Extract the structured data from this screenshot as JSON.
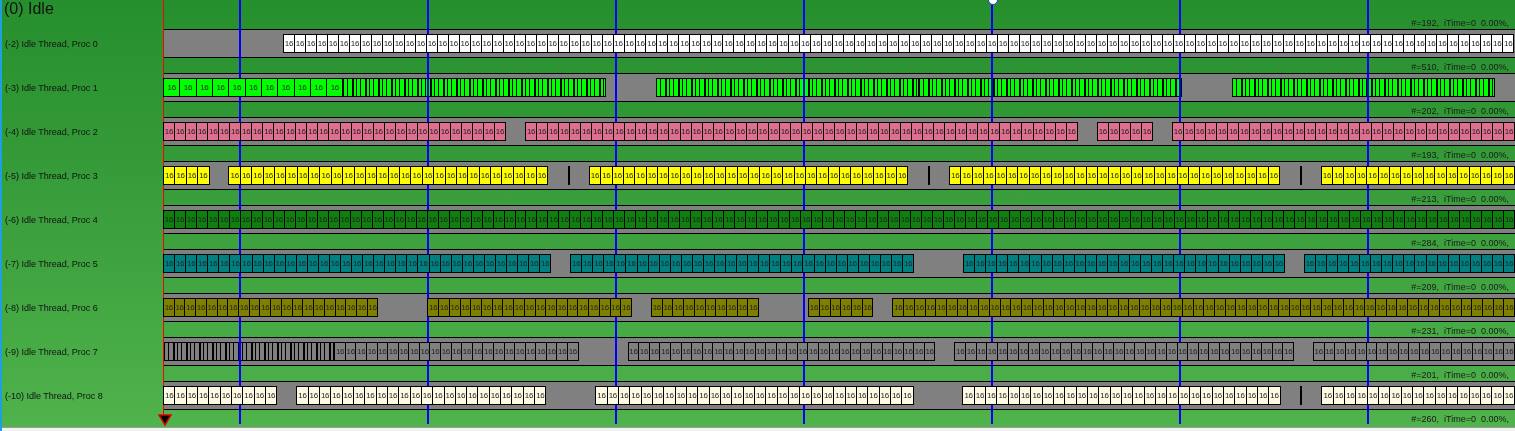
{
  "title": "(0) Idle",
  "rows": [
    {
      "label": "(-2) Idle Thread, Proc 0",
      "color": "#ffffff",
      "stats": "#=192,  iTime=0  0.00%,",
      "segments": [
        {
          "kind": "long_gap"
        },
        {
          "kind": "slices",
          "labels": [
            "16",
            "16",
            "16",
            "16",
            "16",
            "16",
            "16",
            "16",
            "16",
            "16",
            "16",
            "16",
            "16",
            "16",
            "16",
            "16",
            "16",
            "16",
            "16",
            "16",
            "16",
            "16",
            "16",
            "16",
            "16",
            "16",
            "16",
            "16",
            "16",
            "16",
            "16",
            "16",
            "16",
            "16",
            "16",
            "16",
            "16",
            "16",
            "16",
            "16",
            "16",
            "16",
            "16",
            "16",
            "16",
            "16",
            "16",
            "16",
            "16",
            "16",
            "16",
            "16",
            "16",
            "16",
            "16",
            "16",
            "16",
            "16",
            "16",
            "16",
            "16",
            "16",
            "16",
            "16",
            "16",
            "16",
            "16",
            "16",
            "16",
            "16",
            "16",
            "16",
            "16",
            "16",
            "16",
            "16",
            "16",
            "16",
            "16",
            "16",
            "16",
            "16",
            "16",
            "16",
            "16",
            "16",
            "16",
            "16",
            "16",
            "16",
            "16",
            "16",
            "16",
            "16",
            "16",
            "16",
            "16",
            "16",
            "16",
            "16",
            "16",
            "16",
            "16",
            "16",
            "16",
            "16",
            "16",
            "16",
            "16",
            "16",
            "16",
            "16"
          ]
        }
      ]
    },
    {
      "label": "(-3) Idle Thread, Proc 1",
      "color": "#00ff00",
      "stats": "#=510,  iTime=0  0.00%,",
      "segments": [
        {
          "kind": "slices",
          "labels": [
            "16",
            "16",
            "16",
            "16",
            "16",
            "16",
            "16",
            "16",
            "16",
            "16",
            "16"
          ]
        },
        {
          "kind": "stripes"
        },
        {
          "kind": "gap"
        },
        {
          "kind": "stripes"
        },
        {
          "kind": "stripes"
        },
        {
          "kind": "gap"
        },
        {
          "kind": "stripes"
        },
        {
          "kind": "short_gap"
        }
      ]
    },
    {
      "label": "(-4) Idle Thread, Proc 2",
      "color": "#de6f8f",
      "stats": "#=202,  iTime=0  0.00%,",
      "segments": [
        {
          "kind": "slices",
          "labels": [
            "16",
            "16",
            "16",
            "16",
            "16",
            "16",
            "16",
            "16",
            "16",
            "16",
            "16",
            "16",
            "16",
            "16",
            "16",
            "16",
            "16",
            "16",
            "16",
            "16",
            "16",
            "16",
            "16",
            "16",
            "16",
            "16",
            "16",
            "16",
            "16",
            "16",
            "16"
          ]
        },
        {
          "kind": "short_gap"
        },
        {
          "kind": "slices",
          "labels": [
            "16",
            "16",
            "16",
            "16",
            "16",
            "16",
            "16",
            "16",
            "16",
            "16",
            "16",
            "16",
            "16",
            "16",
            "16",
            "16",
            "16",
            "16",
            "16",
            "16",
            "16",
            "16",
            "16",
            "16",
            "16",
            "16",
            "16",
            "16",
            "16",
            "16",
            "16",
            "16",
            "16",
            "16",
            "16",
            "16",
            "16",
            "16",
            "16",
            "16",
            "16",
            "16",
            "16",
            "16",
            "16",
            "16",
            "16",
            "16",
            "16",
            "16"
          ]
        },
        {
          "kind": "short_gap"
        },
        {
          "kind": "slices",
          "labels": [
            "16",
            "16",
            "16",
            "16",
            "16"
          ]
        },
        {
          "kind": "short_gap"
        },
        {
          "kind": "slices",
          "labels": [
            "16",
            "16",
            "16",
            "16",
            "16",
            "16",
            "16",
            "16",
            "16",
            "16",
            "16",
            "16",
            "16",
            "16",
            "16",
            "16",
            "16",
            "16",
            "16",
            "16",
            "16",
            "16",
            "16",
            "16",
            "16",
            "16",
            "16",
            "16",
            "16",
            "16",
            "16"
          ]
        }
      ]
    },
    {
      "label": "(-5) Idle Thread, Proc 3",
      "color": "#ffff00",
      "stats": "#=193,  iTime=0  0.00%,",
      "segments": [
        {
          "kind": "slices",
          "labels": [
            "16",
            "16",
            "16",
            "16"
          ]
        },
        {
          "kind": "short_gap"
        },
        {
          "kind": "slices",
          "labels": [
            "16",
            "16",
            "16",
            "16",
            "16",
            "16",
            "16",
            "16",
            "16",
            "16",
            "16",
            "16",
            "16",
            "16",
            "16",
            "16",
            "16",
            "16",
            "16",
            "16",
            "16",
            "16",
            "16",
            "16",
            "16",
            "16",
            "16",
            "16"
          ]
        },
        {
          "kind": "short_gap"
        },
        {
          "kind": "tick"
        },
        {
          "kind": "short_gap"
        },
        {
          "kind": "slices",
          "labels": [
            "16",
            "16",
            "16",
            "16",
            "16",
            "16",
            "16",
            "16",
            "16",
            "16",
            "16",
            "16",
            "16",
            "16",
            "16",
            "16",
            "16",
            "16",
            "16",
            "16",
            "16",
            "16",
            "16",
            "16",
            "16",
            "16",
            "16",
            "16"
          ]
        },
        {
          "kind": "short_gap"
        },
        {
          "kind": "tick"
        },
        {
          "kind": "short_gap"
        },
        {
          "kind": "slices",
          "labels": [
            "16",
            "16",
            "16",
            "16",
            "16",
            "16",
            "16",
            "16",
            "16",
            "16",
            "16",
            "16",
            "16",
            "16",
            "16",
            "16",
            "16",
            "16",
            "16",
            "16",
            "16",
            "16",
            "16",
            "16",
            "16",
            "16",
            "16",
            "16",
            "16"
          ]
        },
        {
          "kind": "short_gap"
        },
        {
          "kind": "tick"
        },
        {
          "kind": "short_gap"
        },
        {
          "kind": "slices",
          "labels": [
            "16",
            "16",
            "16",
            "16",
            "16",
            "16",
            "16",
            "16",
            "16",
            "16",
            "16",
            "16",
            "16",
            "16",
            "16",
            "16",
            "16"
          ]
        }
      ]
    },
    {
      "label": "(-6) Idle Thread, Proc 4",
      "color": "#0f800f",
      "stats": "#=213,  iTime=0  0.00%,",
      "segments": [
        {
          "kind": "slices",
          "labels": [
            "16",
            "16",
            "16",
            "16",
            "16",
            "16",
            "16",
            "16",
            "16",
            "16",
            "16",
            "16",
            "16",
            "16",
            "16",
            "16",
            "16",
            "16",
            "16",
            "16",
            "16",
            "16",
            "16",
            "16",
            "16",
            "16",
            "16",
            "16",
            "16",
            "16",
            "16",
            "16",
            "16",
            "16",
            "16",
            "16",
            "16",
            "16",
            "16",
            "16",
            "16",
            "16",
            "16",
            "16",
            "16",
            "16",
            "16",
            "16",
            "16",
            "16",
            "16",
            "16",
            "16",
            "16",
            "16",
            "16",
            "16",
            "16",
            "16",
            "16",
            "16",
            "16",
            "16",
            "16",
            "16",
            "16",
            "16",
            "16",
            "16",
            "16",
            "16",
            "16",
            "16",
            "16",
            "16",
            "16",
            "16",
            "16",
            "16",
            "16",
            "16",
            "16",
            "16",
            "16",
            "16",
            "16",
            "16",
            "16",
            "16",
            "16",
            "16",
            "16",
            "16",
            "16",
            "16",
            "16",
            "16",
            "16",
            "16",
            "16",
            "16",
            "16",
            "16",
            "16",
            "16",
            "16",
            "16",
            "16",
            "16",
            "16",
            "16",
            "16",
            "16",
            "16",
            "16",
            "16",
            "16",
            "16",
            "16",
            "16",
            "16",
            "16",
            "16"
          ]
        }
      ]
    },
    {
      "label": "(-7) Idle Thread, Proc 5",
      "color": "#008080",
      "stats": "#=284,  iTime=0  0.00%,",
      "segments": [
        {
          "kind": "slices",
          "labels": [
            "16",
            "16",
            "16",
            "16",
            "16",
            "16",
            "16",
            "16",
            "16",
            "16",
            "16",
            "16",
            "16",
            "16",
            "16",
            "16",
            "16",
            "16",
            "16",
            "16",
            "16",
            "16",
            "16",
            "16",
            "16",
            "16",
            "16",
            "16",
            "16",
            "16",
            "16",
            "16",
            "16",
            "16",
            "16"
          ]
        },
        {
          "kind": "short_gap"
        },
        {
          "kind": "slices",
          "labels": [
            "16",
            "16",
            "16",
            "16",
            "16",
            "16",
            "16",
            "16",
            "16",
            "16",
            "16",
            "16",
            "16",
            "16",
            "16",
            "16",
            "16",
            "16",
            "16",
            "16",
            "16",
            "16",
            "16",
            "16",
            "16",
            "16",
            "16",
            "16",
            "16",
            "16",
            "16"
          ]
        },
        {
          "kind": "gap"
        },
        {
          "kind": "slices",
          "labels": [
            "16",
            "16",
            "16",
            "16",
            "16",
            "16",
            "16",
            "16",
            "16",
            "16",
            "16",
            "16",
            "16",
            "16",
            "16",
            "16",
            "16",
            "16",
            "16",
            "16",
            "16",
            "16",
            "16",
            "16",
            "16",
            "16",
            "16",
            "16",
            "16"
          ]
        },
        {
          "kind": "short_gap"
        },
        {
          "kind": "slices",
          "labels": [
            "16",
            "16",
            "16",
            "16",
            "16",
            "16",
            "16",
            "16",
            "16",
            "16",
            "16",
            "16",
            "16",
            "16",
            "16",
            "16",
            "16",
            "16",
            "16"
          ]
        }
      ]
    },
    {
      "label": "(-8) Idle Thread, Proc 6",
      "color": "#808000",
      "stats": "#=209,  iTime=0  0.00%,",
      "segments": [
        {
          "kind": "slices",
          "labels": [
            "16",
            "16",
            "16",
            "16",
            "16",
            "16",
            "16",
            "16",
            "16",
            "16",
            "16",
            "16",
            "16",
            "16",
            "16",
            "16",
            "16",
            "16",
            "16",
            "16"
          ]
        },
        {
          "kind": "gap"
        },
        {
          "kind": "slices",
          "labels": [
            "16",
            "16",
            "16",
            "16",
            "16",
            "16",
            "16",
            "16",
            "16",
            "16",
            "16",
            "16",
            "16",
            "16",
            "16",
            "16",
            "16",
            "16",
            "16"
          ]
        },
        {
          "kind": "short_gap"
        },
        {
          "kind": "slices",
          "labels": [
            "16",
            "16",
            "16",
            "16",
            "16",
            "16",
            "16",
            "16",
            "16",
            "16"
          ]
        },
        {
          "kind": "gap"
        },
        {
          "kind": "slices",
          "labels": [
            "16",
            "16",
            "16",
            "16",
            "16",
            "16"
          ]
        },
        {
          "kind": "short_gap"
        },
        {
          "kind": "slices",
          "labels": [
            "16",
            "16",
            "16",
            "16",
            "16",
            "16",
            "16",
            "16",
            "16",
            "16",
            "16",
            "16",
            "16",
            "16",
            "16",
            "16",
            "16",
            "16",
            "16",
            "16",
            "16",
            "16",
            "16",
            "16",
            "16",
            "16",
            "16",
            "16",
            "16",
            "16",
            "16",
            "16",
            "16",
            "16",
            "16",
            "16",
            "16",
            "16",
            "16",
            "16",
            "16",
            "16",
            "16",
            "16",
            "16",
            "16",
            "16",
            "16",
            "16",
            "16",
            "16",
            "16",
            "16",
            "16",
            "16",
            "16",
            "16",
            "16"
          ]
        }
      ]
    },
    {
      "label": "(-9) Idle Thread, Proc 7",
      "color": "#808080",
      "stats": "#=231,  iTime=0  0.00%,",
      "segments": [
        {
          "kind": "stripes"
        },
        {
          "kind": "slices",
          "labels": [
            "16",
            "16",
            "16",
            "16",
            "16",
            "16",
            "16",
            "16",
            "16",
            "16",
            "16",
            "16",
            "16",
            "16",
            "16",
            "16",
            "16",
            "16",
            "16",
            "16",
            "16",
            "16",
            "16"
          ]
        },
        {
          "kind": "gap"
        },
        {
          "kind": "slices",
          "labels": [
            "16",
            "16",
            "16",
            "16",
            "16",
            "16",
            "16",
            "16",
            "16",
            "16",
            "16",
            "16",
            "16",
            "16",
            "16",
            "16",
            "16",
            "16",
            "16",
            "16",
            "16",
            "16",
            "16",
            "16",
            "16",
            "16",
            "16",
            "16",
            "16"
          ]
        },
        {
          "kind": "short_gap"
        },
        {
          "kind": "slices",
          "labels": [
            "16",
            "16",
            "16",
            "16",
            "16",
            "16",
            "16",
            "16",
            "16",
            "16",
            "16",
            "16",
            "16",
            "16",
            "16",
            "16",
            "16",
            "16",
            "16",
            "16",
            "16",
            "16",
            "16",
            "16",
            "16",
            "16",
            "16",
            "16",
            "16",
            "16",
            "16",
            "16"
          ]
        },
        {
          "kind": "short_gap"
        },
        {
          "kind": "slices",
          "labels": [
            "16",
            "16",
            "16",
            "16",
            "16",
            "16",
            "16",
            "16",
            "16",
            "16",
            "16",
            "16",
            "16",
            "16",
            "16",
            "16",
            "16",
            "16",
            "16"
          ]
        }
      ]
    },
    {
      "label": "(-10) Idle Thread, Proc 8",
      "color": "#fdf9e2",
      "stats": "#=201,  iTime=0  0.00%,",
      "segments": [
        {
          "kind": "slices",
          "labels": [
            "16",
            "16",
            "16",
            "16",
            "16",
            "16",
            "16",
            "16",
            "16",
            "16"
          ]
        },
        {
          "kind": "short_gap"
        },
        {
          "kind": "slices",
          "labels": [
            "16",
            "16",
            "16",
            "16",
            "16",
            "16",
            "16",
            "16",
            "16",
            "16",
            "16",
            "16",
            "16",
            "16",
            "16",
            "16",
            "16",
            "16",
            "16",
            "16",
            "16",
            "16"
          ]
        },
        {
          "kind": "gap"
        },
        {
          "kind": "slices",
          "labels": [
            "16",
            "16",
            "16",
            "16",
            "16",
            "16",
            "16",
            "16",
            "16",
            "16",
            "16",
            "16",
            "16",
            "16",
            "16",
            "16",
            "16",
            "16",
            "16",
            "16",
            "16",
            "16",
            "16",
            "16",
            "16",
            "16",
            "16",
            "16"
          ]
        },
        {
          "kind": "gap"
        },
        {
          "kind": "slices",
          "labels": [
            "16",
            "16",
            "16",
            "16",
            "16",
            "16",
            "16",
            "16",
            "16",
            "16",
            "16",
            "16",
            "16",
            "16",
            "16",
            "16",
            "16",
            "16",
            "16",
            "16",
            "16",
            "16",
            "16",
            "16",
            "16",
            "16",
            "16",
            "16"
          ]
        },
        {
          "kind": "short_gap"
        },
        {
          "kind": "tick"
        },
        {
          "kind": "short_gap"
        },
        {
          "kind": "slices",
          "labels": [
            "16",
            "16",
            "16",
            "16",
            "16",
            "16",
            "16",
            "16",
            "16",
            "16",
            "16",
            "16",
            "16",
            "16",
            "16",
            "16",
            "16"
          ]
        }
      ]
    }
  ],
  "footer_stats": "#=260,  iTime=0  0.00%,"
}
